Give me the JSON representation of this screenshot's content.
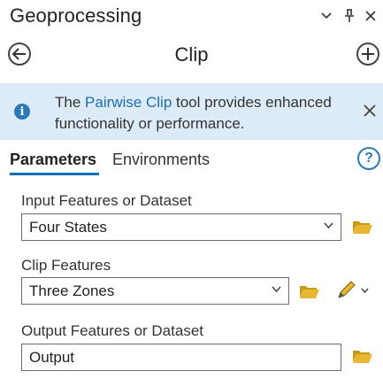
{
  "pane": {
    "title": "Geoprocessing"
  },
  "tool": {
    "title": "Clip"
  },
  "banner": {
    "text_before": "The ",
    "link": "Pairwise Clip",
    "text_after": " tool provides enhanced functionality or performance."
  },
  "tabs": [
    {
      "label": "Parameters",
      "active": true
    },
    {
      "label": "Environments",
      "active": false
    }
  ],
  "params": {
    "input": {
      "label": "Input Features or Dataset",
      "value": "Four States"
    },
    "clip": {
      "label": "Clip Features",
      "value": "Three Zones"
    },
    "output": {
      "label": "Output Features or Dataset",
      "value": "Output"
    }
  },
  "icons": {
    "options": "chevron-down-icon",
    "pin": "pin-icon",
    "close": "close-icon",
    "back": "back-arrow-icon",
    "add": "add-icon",
    "info": "info-icon",
    "help": "help-icon",
    "browse": "folder-icon",
    "sketch": "pencil-icon"
  },
  "colors": {
    "accent": "#1b6fb5",
    "banner_bg": "#dcebf7",
    "folder": "#e8b731"
  }
}
